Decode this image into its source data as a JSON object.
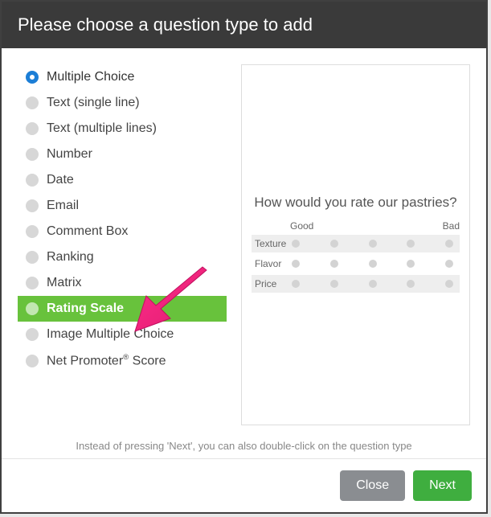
{
  "header": {
    "title": "Please choose a question type to add"
  },
  "types": [
    {
      "label": "Multiple Choice",
      "state": "selected"
    },
    {
      "label": "Text (single line)",
      "state": ""
    },
    {
      "label": "Text (multiple lines)",
      "state": ""
    },
    {
      "label": "Number",
      "state": ""
    },
    {
      "label": "Date",
      "state": ""
    },
    {
      "label": "Email",
      "state": ""
    },
    {
      "label": "Comment Box",
      "state": ""
    },
    {
      "label": "Ranking",
      "state": ""
    },
    {
      "label": "Matrix",
      "state": ""
    },
    {
      "label": "Rating Scale",
      "state": "highlighted"
    },
    {
      "label": "Image Multiple Choice",
      "state": ""
    },
    {
      "label": "Net Promoter® Score",
      "state": ""
    }
  ],
  "preview": {
    "title": "How would you rate our pastries?",
    "scale_left": "Good",
    "scale_right": "Bad",
    "rows": [
      "Texture",
      "Flavor",
      "Price"
    ]
  },
  "hint": "Instead of pressing 'Next', you can also double-click on the question type",
  "footer": {
    "close": "Close",
    "next": "Next"
  }
}
